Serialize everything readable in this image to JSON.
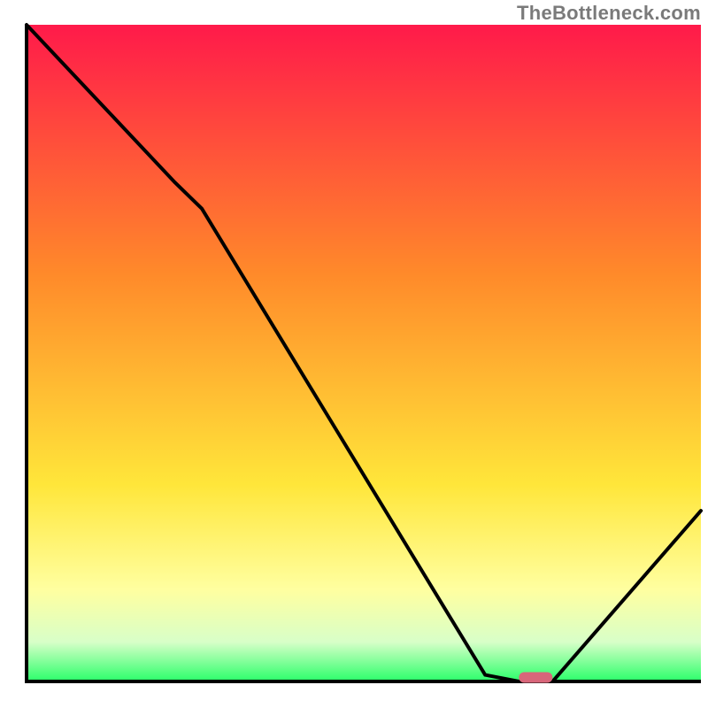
{
  "watermark": "TheBottleneck.com",
  "colors": {
    "gradient_top": "#ff1a4a",
    "gradient_mid_orange": "#ff8a2a",
    "gradient_mid_yellow": "#ffe63a",
    "gradient_mid_light_yellow": "#ffffa0",
    "gradient_mid_light_green": "#d8ffc8",
    "gradient_bottom": "#2aff6a",
    "curve": "#000000",
    "axis": "#000000",
    "marker": "#d8667a",
    "background": "#ffffff"
  },
  "chart_data": {
    "type": "line",
    "title": "",
    "xlabel": "",
    "ylabel": "",
    "xlim": [
      0,
      100
    ],
    "ylim": [
      0,
      100
    ],
    "grid": false,
    "legend": false,
    "annotations": [
      "TheBottleneck.com"
    ],
    "series": [
      {
        "name": "bottleneck-curve",
        "x": [
          0,
          22,
          26,
          68,
          73,
          78,
          100
        ],
        "y": [
          100,
          76,
          72,
          1,
          0,
          0,
          26
        ]
      }
    ],
    "marker": {
      "name": "optimal-range",
      "x_start": 73,
      "x_end": 78,
      "y": 0.6
    }
  }
}
